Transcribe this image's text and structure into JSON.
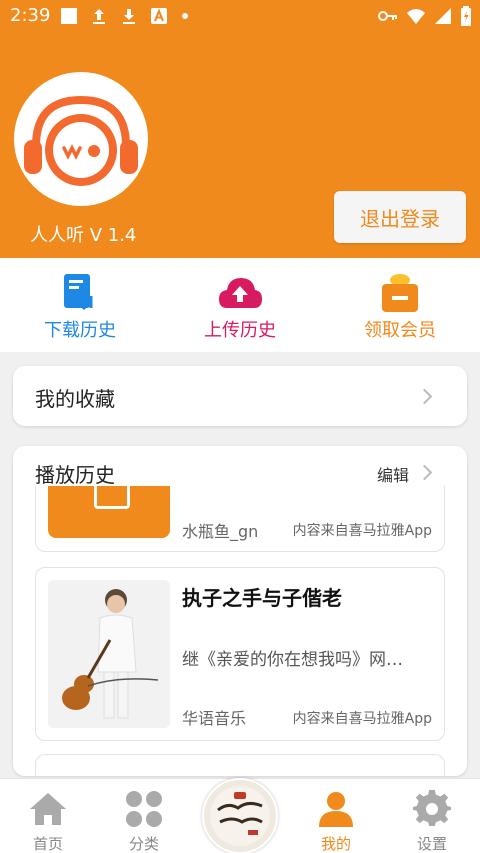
{
  "status_bar": {
    "time": "2:39",
    "icons": [
      "square-icon",
      "upload-arrow-icon",
      "download-arrow-icon",
      "a-badge-icon",
      "dot-icon",
      "key-icon",
      "wifi-icon",
      "signal-icon",
      "battery-icon"
    ]
  },
  "profile": {
    "app_version": "人人听 V 1.4",
    "logout_label": "退出登录"
  },
  "quick_actions": [
    {
      "label": "下载历史",
      "icon": "download-history-icon",
      "color": "#1e88e5"
    },
    {
      "label": "上传历史",
      "icon": "upload-cloud-icon",
      "color": "#d81b60"
    },
    {
      "label": "领取会员",
      "icon": "gift-box-icon",
      "color": "#f08a1c"
    }
  ],
  "favorites": {
    "title": "我的收藏"
  },
  "history": {
    "title": "播放历史",
    "edit_label": "编辑",
    "items": [
      {
        "title": "",
        "description": "",
        "author": "水瓶鱼_gn",
        "source": "内容来自喜马拉雅App"
      },
      {
        "title": "执子之手与子偕老",
        "description": "继《亲爱的你在想我吗》网…",
        "author": "华语音乐",
        "source": "内容来自喜马拉雅App"
      }
    ]
  },
  "bottom_nav": {
    "items": [
      {
        "label": "首页",
        "icon": "home-icon"
      },
      {
        "label": "分类",
        "icon": "category-grid-icon"
      },
      {
        "label": "我的",
        "icon": "person-icon",
        "active": true
      },
      {
        "label": "设置",
        "icon": "gear-icon"
      }
    ]
  },
  "colors": {
    "brand": "#f08a1c",
    "download": "#1e88e5",
    "upload": "#d81b60",
    "inactive_nav": "#888888"
  }
}
